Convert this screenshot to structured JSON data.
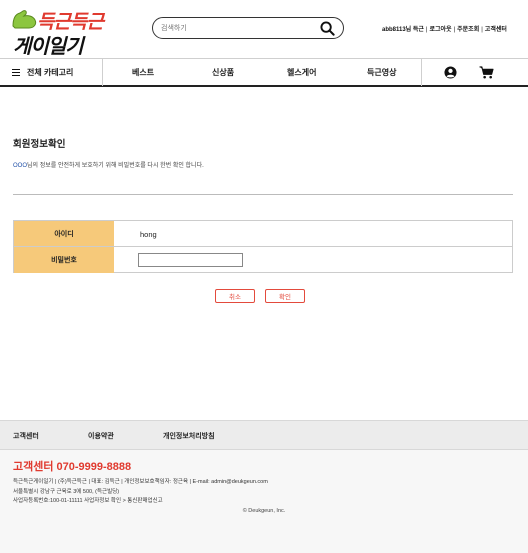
{
  "header": {
    "logo_top": "득근득근",
    "logo_bottom": "게이일기",
    "search_placeholder": "검색하기",
    "top_links": [
      "abb8113님 득근",
      "로그아웃",
      "주문조회",
      "고객센터"
    ]
  },
  "nav": {
    "category_label": "전체 카테고리",
    "items": [
      "베스트",
      "신상품",
      "헬스게어",
      "득근영상"
    ]
  },
  "main": {
    "title": "회원정보확인",
    "desc_highlight": "OOO",
    "desc_rest": "님의 정보를 안전하게 보호하기 위해 비밀번호를 다시 한번 확인 합니다.",
    "form": {
      "id_label": "아이디",
      "id_value": "hong",
      "pw_label": "비밀번호",
      "pw_value": ""
    },
    "cancel_label": "취소",
    "confirm_label": "확인"
  },
  "footer": {
    "links": [
      "고객센터",
      "이용약관",
      "개인정보처리방침"
    ],
    "cs_title": "고객센터 070-9999-8888",
    "info_lines": [
      "득근득근게이일기 | (주)득근득근 | 대표: 김득근 | 개인정보보호책임자: 정근육 | E-mail: admin@deukgeun.com",
      "서울특별시 강남구 근육로 3에 500, (득근빌딩)",
      "사업자등록번호:100-01-11111 사업자정보 확인 > 통신판매업신고"
    ],
    "copyright": "© Deukgeun, Inc."
  },
  "colors": {
    "accent_red": "#e03a2f",
    "form_header": "#f6c97a",
    "link_blue": "#1f4fa8"
  },
  "icons": [
    "muscle-arm-logo-icon",
    "search-icon",
    "hamburger-icon",
    "user-icon",
    "cart-icon"
  ]
}
